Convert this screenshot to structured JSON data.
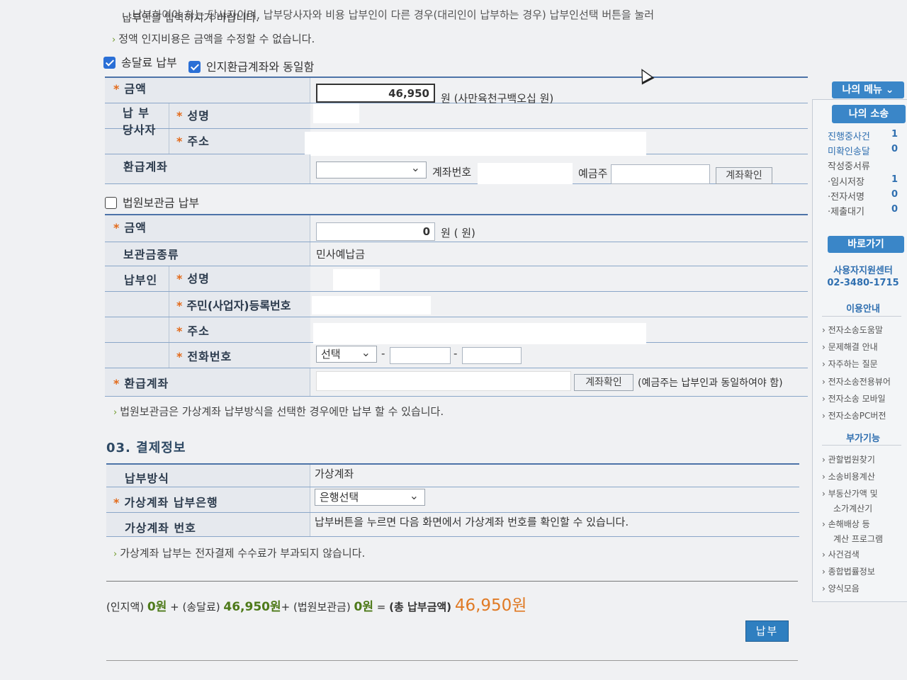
{
  "intro": {
    "line1": "…납부하여야 하는 당사자이며, 납부당사자와 비용 납부인이 다른 경우(대리인이 납부하는 경우) 납부인선택 버튼을 눌러",
    "line2": "납부인을 입력하시기 바랍니다.",
    "fixed_notice": "정액 인지비용은 금액을 수정할 수 없습니다."
  },
  "delivery": {
    "check_label": "송달료 납부",
    "same_account_label": "인지환급계좌와 동일함",
    "amount_label": "금액",
    "amount_value": "46,950",
    "amount_korean": "원 (사만육천구백오십 원)",
    "payer_label": "납 부 당사자",
    "name_label": "성명",
    "address_label": "주소",
    "refund_label": "환급계좌",
    "account_no_label": "계좌번호",
    "holder_label": "예금주",
    "verify_btn": "계좌확인"
  },
  "deposit": {
    "check_label": "법원보관금 납부",
    "amount_label": "금액",
    "amount_value": "0",
    "amount_korean": "원 ( 원)",
    "type_label": "보관금종류",
    "type_value": "민사예납금",
    "payer_label": "납부인",
    "name_label": "성명",
    "id_label": "주민(사업자)등록번호",
    "address_label": "주소",
    "phone_label": "전화번호",
    "phone_select": "선택",
    "dash": "-",
    "refund_label": "환급계좌",
    "verify_btn": "계좌확인",
    "refund_note": "(예금주는 납부인과 동일하여야 함)",
    "notice": "법원보관금은 가상계좌 납부방식을 선택한 경우에만 납부 할 수 있습니다."
  },
  "payment": {
    "title": "03. 결제정보",
    "method_label": "납부방식",
    "method_value": "가상계좌",
    "bank_label": "가상계좌 납부은행",
    "bank_select": "은행선택",
    "vacct_label": "가상계좌 번호",
    "vacct_value": "납부버튼을 누르면 다음 화면에서 가상계좌 번호를 확인할 수 있습니다.",
    "notice": "가상계좌 납부는 전자결제 수수료가 부과되지 않습니다."
  },
  "total": {
    "stamp_label": "(인지액)",
    "stamp_value": "0원",
    "plus1": "+",
    "delivery_label": "(송달료)",
    "delivery_value": "46,950원",
    "plus2": "+",
    "deposit_label": "(법원보관금)",
    "deposit_value": "0원",
    "eq": "=",
    "sum_label": "(총 납부금액)",
    "sum_value": "46,950원"
  },
  "pay_button": "납부",
  "sidebar": {
    "my_menu": "나의 메뉴",
    "my_case": "나의 소송",
    "case_items": [
      {
        "label": "진행중사건",
        "count": "1"
      },
      {
        "label": "미확인송달",
        "count": "0"
      },
      {
        "label": "작성중서류",
        "count": ""
      },
      {
        "label": "·임시저장",
        "count": "1"
      },
      {
        "label": "·전자서명",
        "count": "0"
      },
      {
        "label": "·제출대기",
        "count": "0"
      }
    ],
    "shortcut": "바로가기",
    "support_center": "사용자지원센터",
    "support_phone": "02-3480-1715",
    "guide_head": "이용안내",
    "guide_items": [
      "전자소송도움말",
      "문제해결 안내",
      "자주하는 질문",
      "전자소송전용뷰어",
      "전자소송 모바일",
      "전자소송PC버전"
    ],
    "extra_head": "부가기능",
    "extra_items": [
      "관할법원찾기",
      "소송비용계산",
      "부동산가액 및",
      "소가계산기",
      "손해배상 등",
      "계산 프로그램",
      "사건검색",
      "종합법률정보",
      "양식모음"
    ]
  }
}
